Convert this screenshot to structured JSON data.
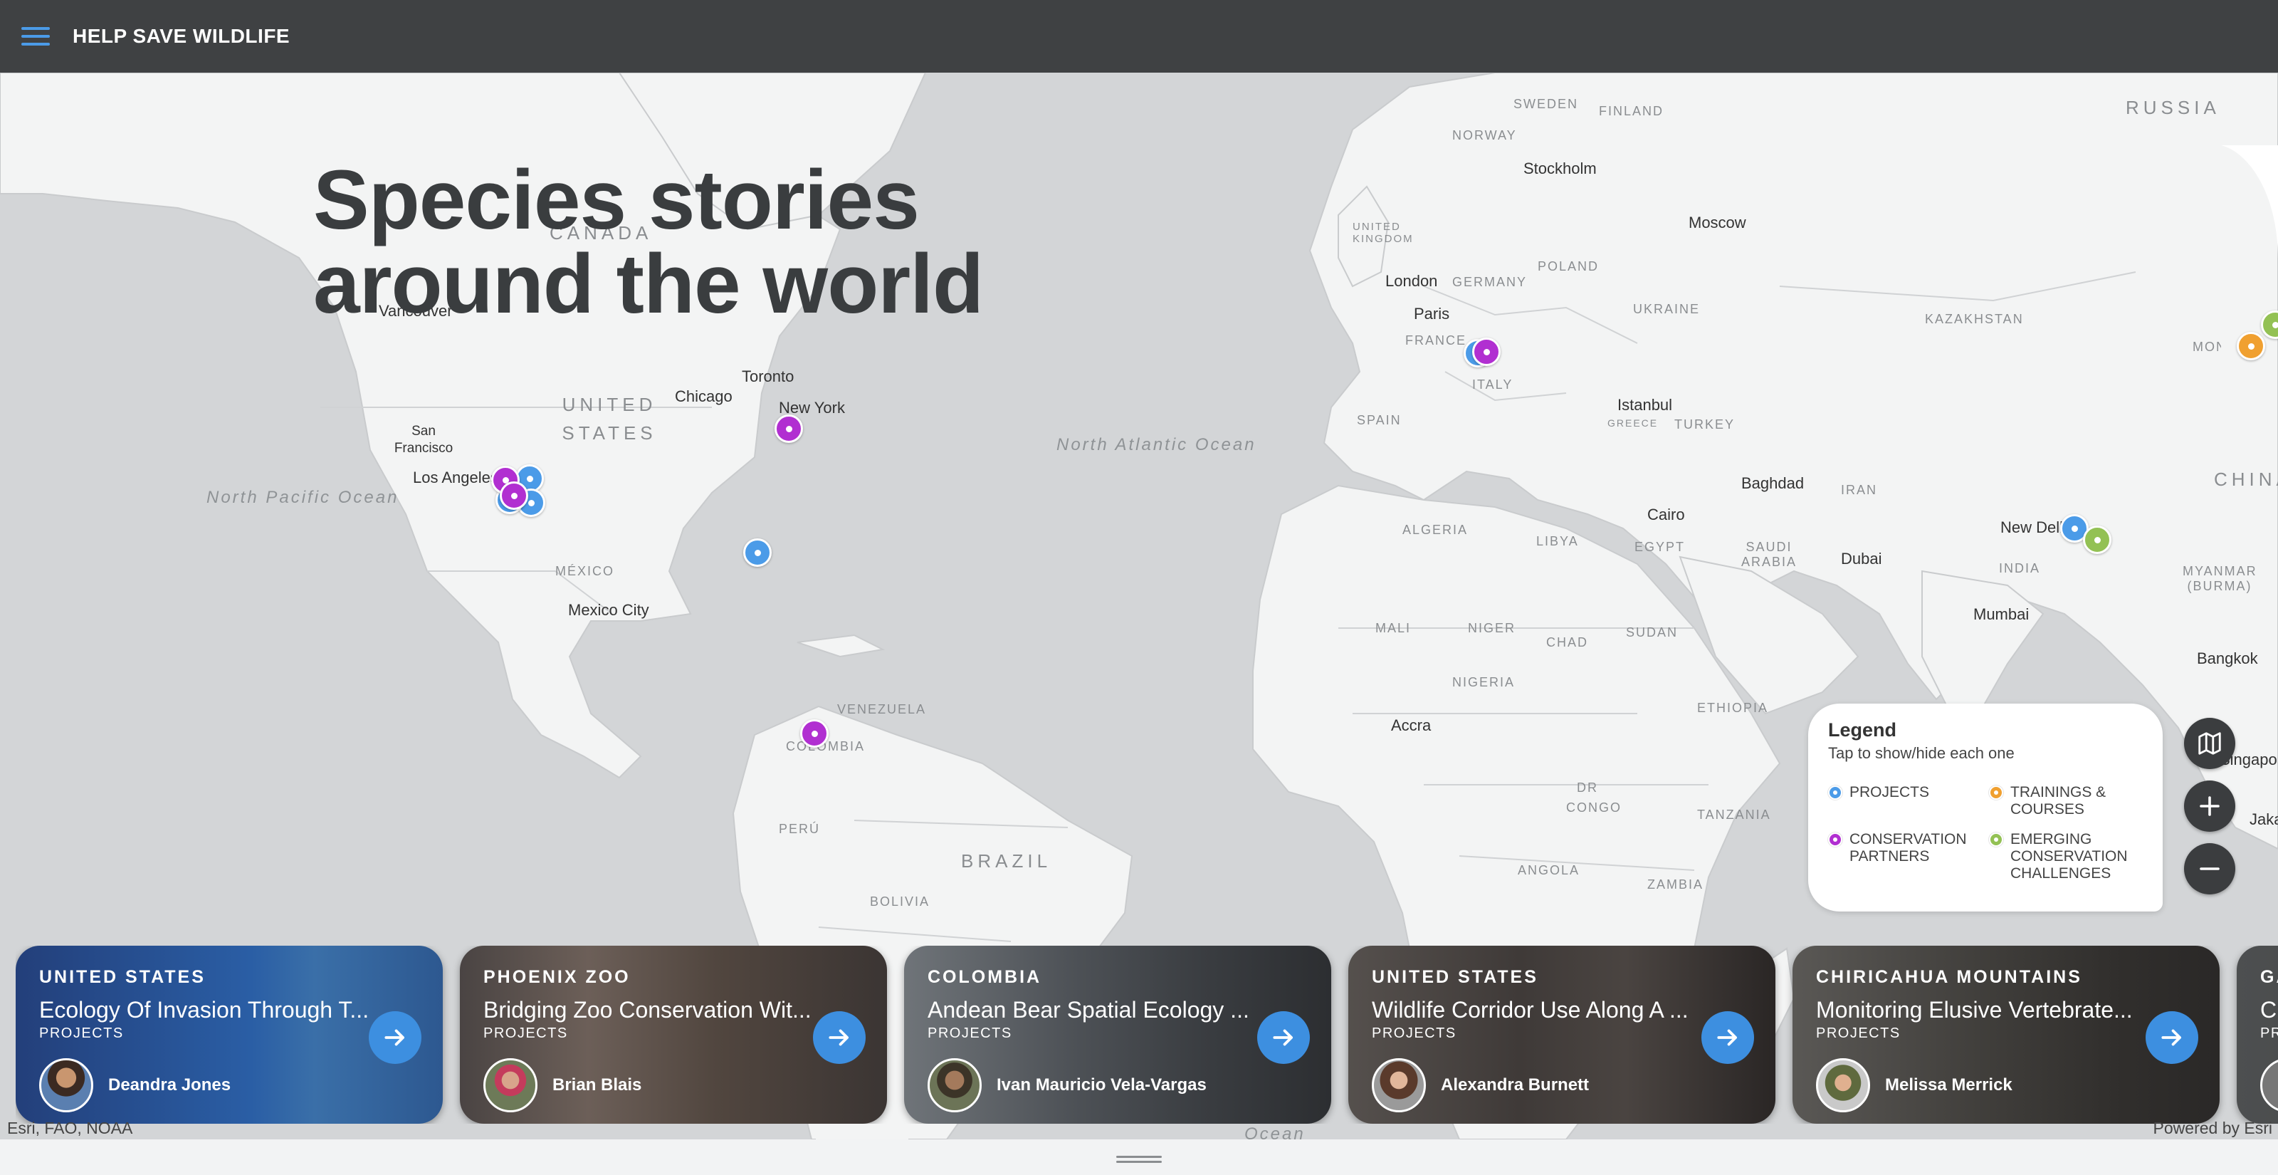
{
  "header": {
    "app_title": "HELP SAVE WILDLIFE",
    "menu_icon": "hamburger-menu-icon"
  },
  "headline": {
    "line1": "Species stories",
    "line2": "around the world"
  },
  "map_labels": {
    "cities": [
      "Stockholm",
      "Moscow",
      "London",
      "Paris",
      "Vancouver",
      "Toronto",
      "Chicago",
      "New York",
      "San Francisco",
      "Los Angeles",
      "Mexico City",
      "Istanbul",
      "Baghdad",
      "Cairo",
      "Dubai",
      "New Delhi",
      "Mumbai",
      "Bangkok",
      "Accra",
      "Singapore",
      "Jakarta"
    ],
    "countries": [
      "SWEDEN",
      "FINLAND",
      "NORWAY",
      "RUSSIA",
      "UNITED KINGDOM",
      "GERMANY",
      "POLAND",
      "UKRAINE",
      "KAZAKHSTAN",
      "FRANCE",
      "ITALY",
      "SPAIN",
      "TURKEY",
      "IRAN",
      "CHINA",
      "ALGERIA",
      "LIBYA",
      "EGYPT",
      "SAUDI ARABIA",
      "INDIA",
      "MYANMAR (BURMA)",
      "MALI",
      "NIGER",
      "CHAD",
      "SUDAN",
      "NIGERIA",
      "ETHIOPIA",
      "DR CONGO",
      "TANZANIA",
      "ANGOLA",
      "ZAMBIA",
      "CANADA",
      "UNITED STATES",
      "MÉXICO",
      "VENEZUELA",
      "COLOMBIA",
      "PERÚ",
      "BRAZIL",
      "BOLIVIA",
      "GREECE",
      "MONGOLIA"
    ],
    "oceans": {
      "north_pacific": "North Pacific Ocean",
      "north_atlantic": "North Atlantic Ocean",
      "bottom": "Ocean"
    }
  },
  "legend": {
    "title": "Legend",
    "subtitle": "Tap to show/hide each one",
    "items": [
      {
        "label": "PROJECTS",
        "color": "#4b9be8"
      },
      {
        "label": "TRAININGS & COURSES",
        "color": "#f0a030"
      },
      {
        "label": "CONSERVATION PARTNERS",
        "color": "#b12fd1"
      },
      {
        "label": "EMERGING CONSERVATION CHALLENGES",
        "color": "#93c154"
      }
    ]
  },
  "map_controls": {
    "basemap_icon": "map-icon",
    "zoom_in_icon": "plus-icon",
    "zoom_out_icon": "minus-icon"
  },
  "cards": [
    {
      "region": "UNITED STATES",
      "title": "Ecology Of Invasion Through T...",
      "category": "PROJECTS",
      "author": "Deandra Jones"
    },
    {
      "region": "PHOENIX ZOO",
      "title": "Bridging Zoo Conservation Wit...",
      "category": "PROJECTS",
      "author": "Brian Blais"
    },
    {
      "region": "COLOMBIA",
      "title": "Andean Bear Spatial Ecology ...",
      "category": "PROJECTS",
      "author": "Ivan Mauricio Vela-Vargas"
    },
    {
      "region": "UNITED STATES",
      "title": "Wildlife Corridor Use Along A ...",
      "category": "PROJECTS",
      "author": "Alexandra Burnett"
    },
    {
      "region": "CHIRICAHUA MOUNTAINS",
      "title": "Monitoring Elusive Vertebrate...",
      "category": "PROJECTS",
      "author": "Melissa Merrick"
    },
    {
      "region": "GA",
      "title": "C",
      "category": "PR",
      "author": ""
    }
  ],
  "attribution": {
    "left": "Esri, FAO, NOAA",
    "right": "Powered by Esri"
  },
  "colors": {
    "topbar": "#3f4143",
    "accent_blue": "#4b9be8",
    "partners_purple": "#b12fd1",
    "trainings_orange": "#f0a030",
    "emerging_green": "#93c154"
  }
}
